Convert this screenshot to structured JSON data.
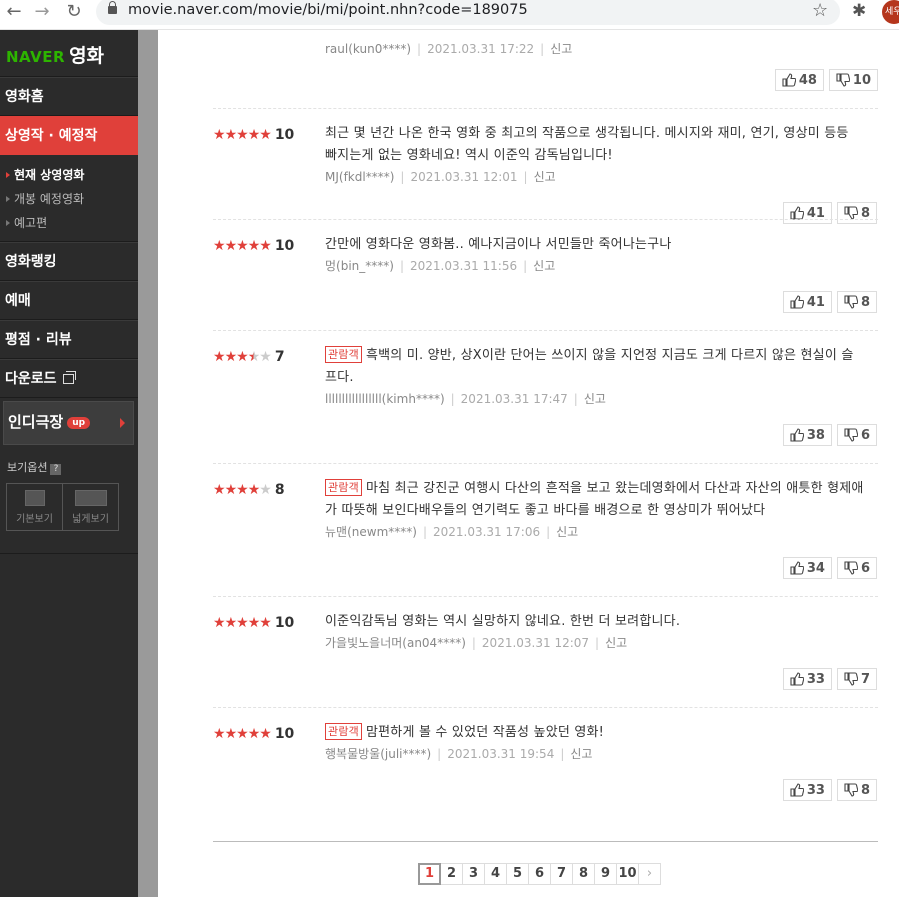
{
  "browser": {
    "url": "movie.naver.com/movie/bi/mi/point.nhn?code=189075",
    "back_icon": "←",
    "forward_icon": "→",
    "reload_icon": "↻",
    "bookmark_icon": "☆",
    "extension_icon": "✱",
    "profile_label": "세우"
  },
  "sidebar": {
    "logo_naver": "NAVER",
    "logo_movie": "영화",
    "items": [
      {
        "label": "영화홈"
      },
      {
        "label": "상영작 · 예정작"
      },
      {
        "label": "영화랭킹"
      },
      {
        "label": "예매"
      },
      {
        "label": "평점 · 리뷰"
      },
      {
        "label": "다운로드"
      }
    ],
    "sub_items": [
      {
        "label": "현재 상영영화"
      },
      {
        "label": "개봉 예정영화"
      },
      {
        "label": "예고편"
      }
    ],
    "indie_label": "인디극장",
    "indie_badge": "up",
    "view_option_label": "보기옵션",
    "view_option_help": "?",
    "view_basic": "기본보기",
    "view_wide": "넓게보기"
  },
  "first_review_meta": {
    "user": "raul(kun0****)",
    "date": "2021.03.31 17:22",
    "report": "신고",
    "up": "48",
    "down": "10"
  },
  "reviews": [
    {
      "stars": 5,
      "half": false,
      "score": "10",
      "badge": "",
      "text": "최근 몇 년간 나온 한국 영화 중 최고의 작품으로 생각됩니다. 메시지와 재미, 연기, 영상미 등등 빠지는게 없는 영화네요! 역시 이준익 감독님입니다!",
      "user": "MJ(fkdl****)",
      "date": "2021.03.31 12:01",
      "report": "신고",
      "up": "41",
      "down": "8"
    },
    {
      "stars": 5,
      "half": false,
      "score": "10",
      "badge": "",
      "text": "간만에 영화다운 영화봄.. 예나지금이나 서민들만 죽어나는구나",
      "user": "멍(bin_****)",
      "date": "2021.03.31 11:56",
      "report": "신고",
      "up": "41",
      "down": "8"
    },
    {
      "stars": 3,
      "half": true,
      "score": "7",
      "badge": "관람객",
      "text": "흑백의 미. 양반, 상X이란 단어는 쓰이지 않을 지언정 지금도 크게 다르지 않은 현실이 슬프다.",
      "user": "lllllllllllllllll(kimh****)",
      "date": "2021.03.31 17:47",
      "report": "신고",
      "up": "38",
      "down": "6"
    },
    {
      "stars": 4,
      "half": false,
      "score": "8",
      "badge": "관람객",
      "text": "마침 최근 강진군 여행시 다산의 흔적을 보고 왔는데영화에서 다산과 자산의 애틋한 형제애가 따뜻해 보인다배우들의 연기력도 좋고 바다를 배경으로 한 영상미가 뛰어났다",
      "user": "뉴맨(newm****)",
      "date": "2021.03.31 17:06",
      "report": "신고",
      "up": "34",
      "down": "6"
    },
    {
      "stars": 5,
      "half": false,
      "score": "10",
      "badge": "",
      "text": "이준익감독님 영화는 역시 실망하지 않네요. 한번 더 보려합니다.",
      "user": "가을빛노을너머(an04****)",
      "date": "2021.03.31 12:07",
      "report": "신고",
      "up": "33",
      "down": "7"
    },
    {
      "stars": 5,
      "half": false,
      "score": "10",
      "badge": "관람객",
      "text": "맘편하게 볼 수 있었던 작품성 높았던 영화!",
      "user": "행복물방울(juli****)",
      "date": "2021.03.31 19:54",
      "report": "신고",
      "up": "33",
      "down": "8"
    }
  ],
  "pagination": {
    "pages": [
      "1",
      "2",
      "3",
      "4",
      "5",
      "6",
      "7",
      "8",
      "9",
      "10"
    ],
    "current": "1",
    "next_icon": "›"
  }
}
